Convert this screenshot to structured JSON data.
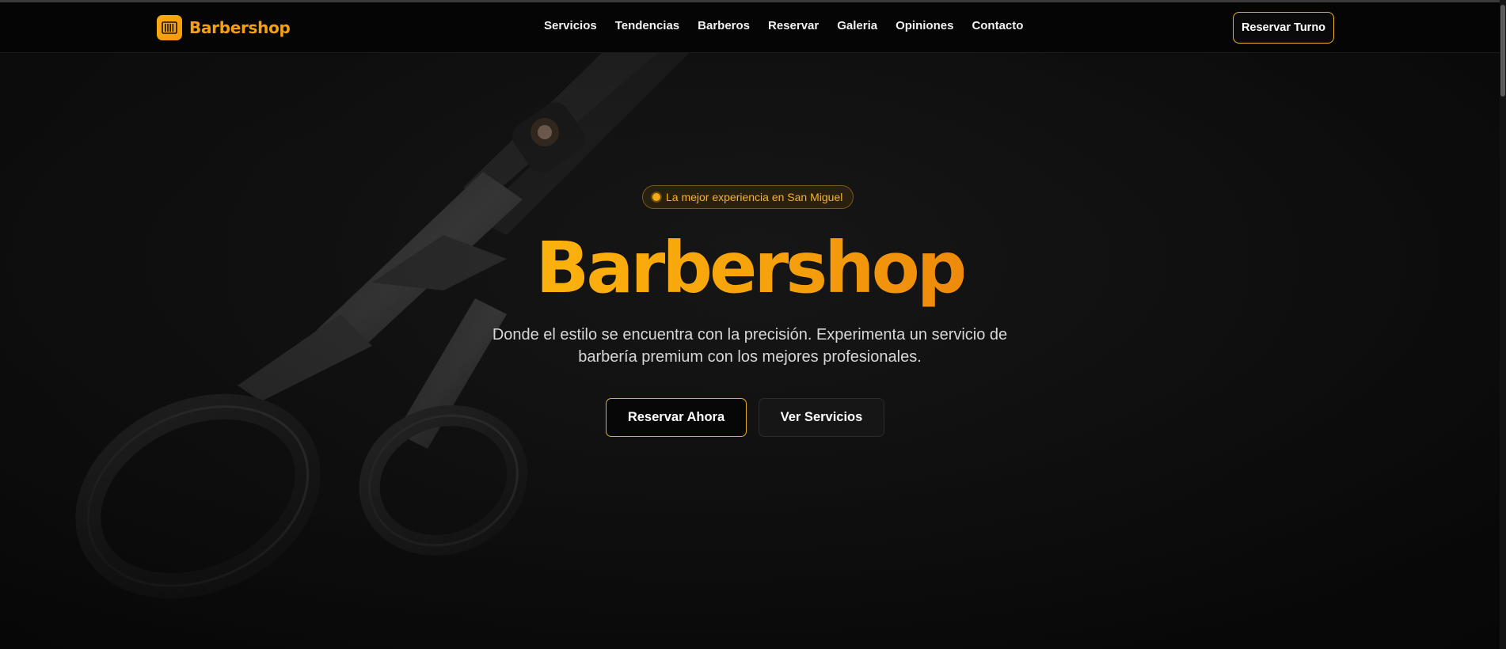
{
  "navbar": {
    "brand": {
      "name": "Barbershop",
      "icon": "barber-pole-icon"
    },
    "links": [
      {
        "label": "Servicios"
      },
      {
        "label": "Tendencias"
      },
      {
        "label": "Barberos"
      },
      {
        "label": "Reservar"
      },
      {
        "label": "Galeria"
      },
      {
        "label": "Opiniones"
      },
      {
        "label": "Contacto"
      }
    ],
    "cta_label": "Reservar Turno"
  },
  "hero": {
    "badge_text": "La mejor experiencia en San Miguel",
    "title": "Barbershop",
    "subtitle": "Donde el estilo se encuentra con la precisión. Experimenta un servicio de barbería premium con los mejores profesionales.",
    "primary_button": "Reservar Ahora",
    "secondary_button": "Ver Servicios",
    "background_image": "scissors"
  },
  "colors": {
    "accent": "#f5a10f",
    "accent_dark": "#ee8a0c",
    "background": "#0b0b0b",
    "border_gold": "#f0b323"
  }
}
